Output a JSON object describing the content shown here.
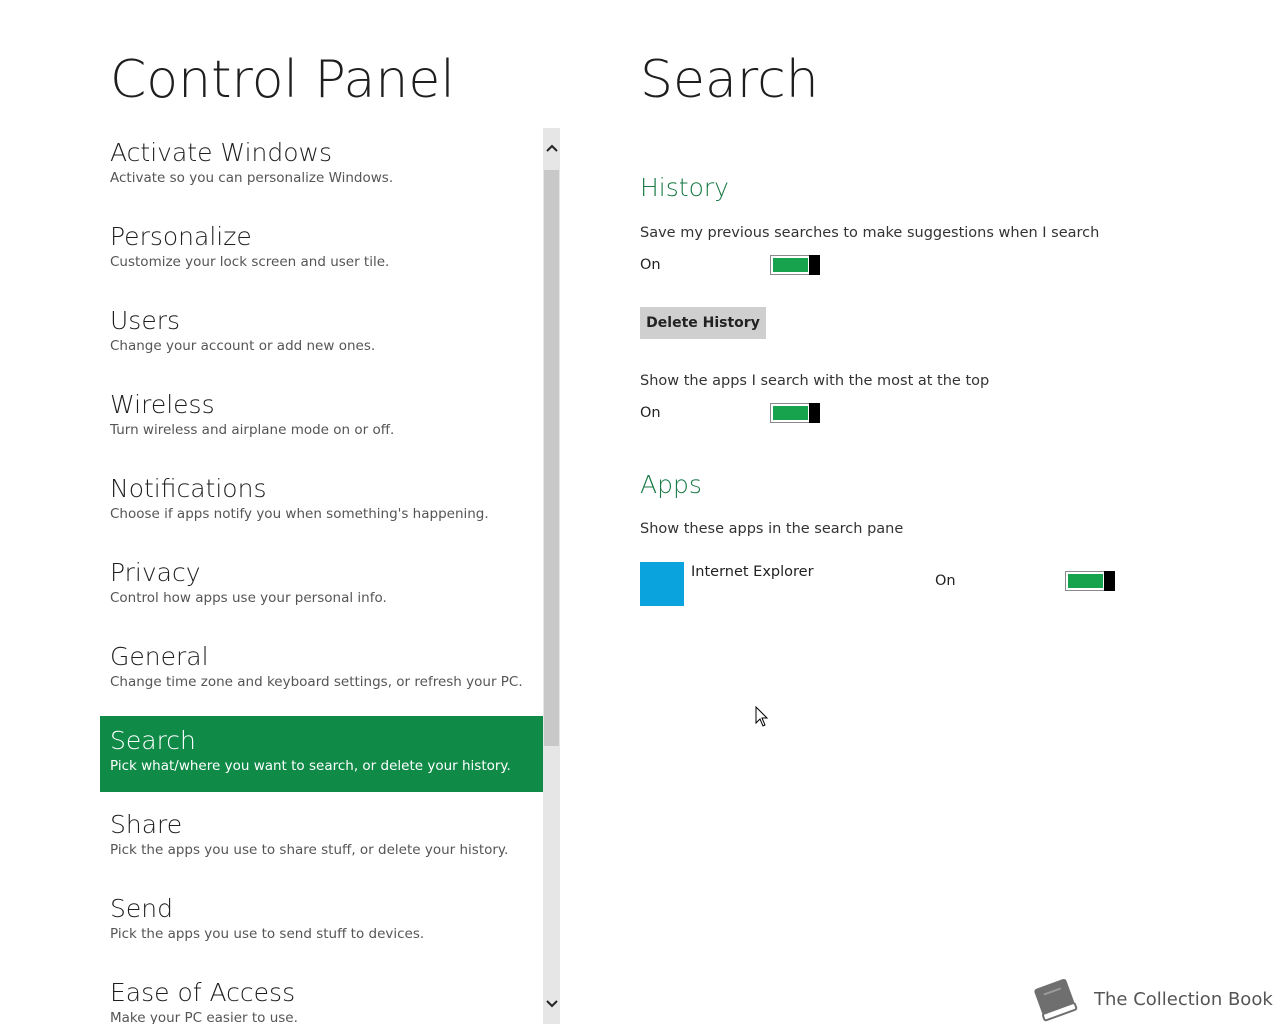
{
  "left_pane": {
    "title": "Control Panel",
    "selected_index": 7,
    "items": [
      {
        "title": "Activate Windows",
        "desc": "Activate so you can personalize Windows."
      },
      {
        "title": "Personalize",
        "desc": "Customize your lock screen and user tile."
      },
      {
        "title": "Users",
        "desc": "Change your account or add new ones."
      },
      {
        "title": "Wireless",
        "desc": "Turn wireless and airplane mode on or off."
      },
      {
        "title": "Notifications",
        "desc": "Choose if apps notify you when something's happening."
      },
      {
        "title": "Privacy",
        "desc": "Control how apps use your personal info."
      },
      {
        "title": "General",
        "desc": "Change time zone and keyboard settings, or refresh your PC."
      },
      {
        "title": "Search",
        "desc": "Pick what/where you want to search, or delete your history."
      },
      {
        "title": "Share",
        "desc": "Pick the apps you use to share stuff, or delete your history."
      },
      {
        "title": "Send",
        "desc": "Pick the apps you use to send stuff to devices."
      },
      {
        "title": "Ease of Access",
        "desc": "Make your PC easier to use."
      }
    ]
  },
  "scrollbar": {
    "up_icon": "chevron-up",
    "down_icon": "chevron-down"
  },
  "right_pane": {
    "title": "Search",
    "history": {
      "heading": "History",
      "save_searches_label": "Save my previous searches to make suggestions when I search",
      "save_searches_state": "On",
      "delete_history_button": "Delete History",
      "show_top_apps_label": "Show the apps I search with the most at the top",
      "show_top_apps_state": "On"
    },
    "apps": {
      "heading": "Apps",
      "description": "Show these apps in the search pane",
      "items": [
        {
          "name": "Internet Explorer",
          "state": "On",
          "tile_color": "#0aa3dd"
        }
      ]
    }
  },
  "watermark": {
    "text": "The Collection Book",
    "icon": "book-icon"
  },
  "colors": {
    "accent_green": "#0f8a47",
    "heading_green": "#1a7a46",
    "toggle_on": "#17a34e"
  }
}
